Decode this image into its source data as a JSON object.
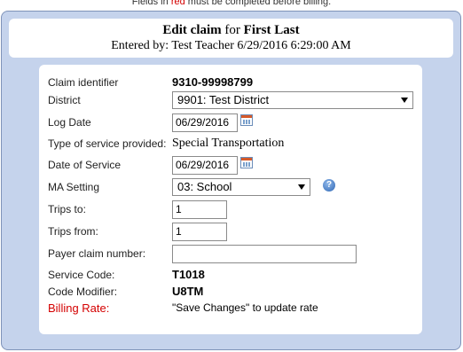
{
  "notice": {
    "prefix": "Fields in ",
    "highlight": "red",
    "suffix": " must be completed before billing."
  },
  "header": {
    "title_prefix": "Edit claim",
    "title_for": " for ",
    "patient_name": "First Last",
    "entered_by": "Entered by: Test Teacher 6/29/2016 6:29:00 AM"
  },
  "form": {
    "claim_identifier": {
      "label": "Claim identifier",
      "value": "9310-99998799"
    },
    "district": {
      "label": "District",
      "selected": "9901: Test District"
    },
    "log_date": {
      "label": "Log Date",
      "value": "06/29/2016"
    },
    "service_type": {
      "label": "Type of service provided:",
      "value": "Special Transportation"
    },
    "date_of_service": {
      "label": "Date of Service",
      "value": "06/29/2016"
    },
    "ma_setting": {
      "label": "MA Setting",
      "selected": "03: School"
    },
    "trips_to": {
      "label": "Trips to:",
      "value": "1"
    },
    "trips_from": {
      "label": "Trips from:",
      "value": "1"
    },
    "payer_claim_number": {
      "label": "Payer claim number:",
      "value": ""
    },
    "service_code": {
      "label": "Service Code:",
      "value": "T1018"
    },
    "code_modifier": {
      "label": "Code Modifier:",
      "value": "U8TM"
    },
    "billing_rate": {
      "label": "Billing Rate:",
      "value": "\"Save Changes\" to update rate"
    }
  },
  "icons": {
    "calendar": "calendar-icon",
    "help": "help-icon",
    "dropdown": "chevron-down-icon"
  },
  "colors": {
    "required": "#d40000",
    "frame_background": "#c5d3ec"
  }
}
